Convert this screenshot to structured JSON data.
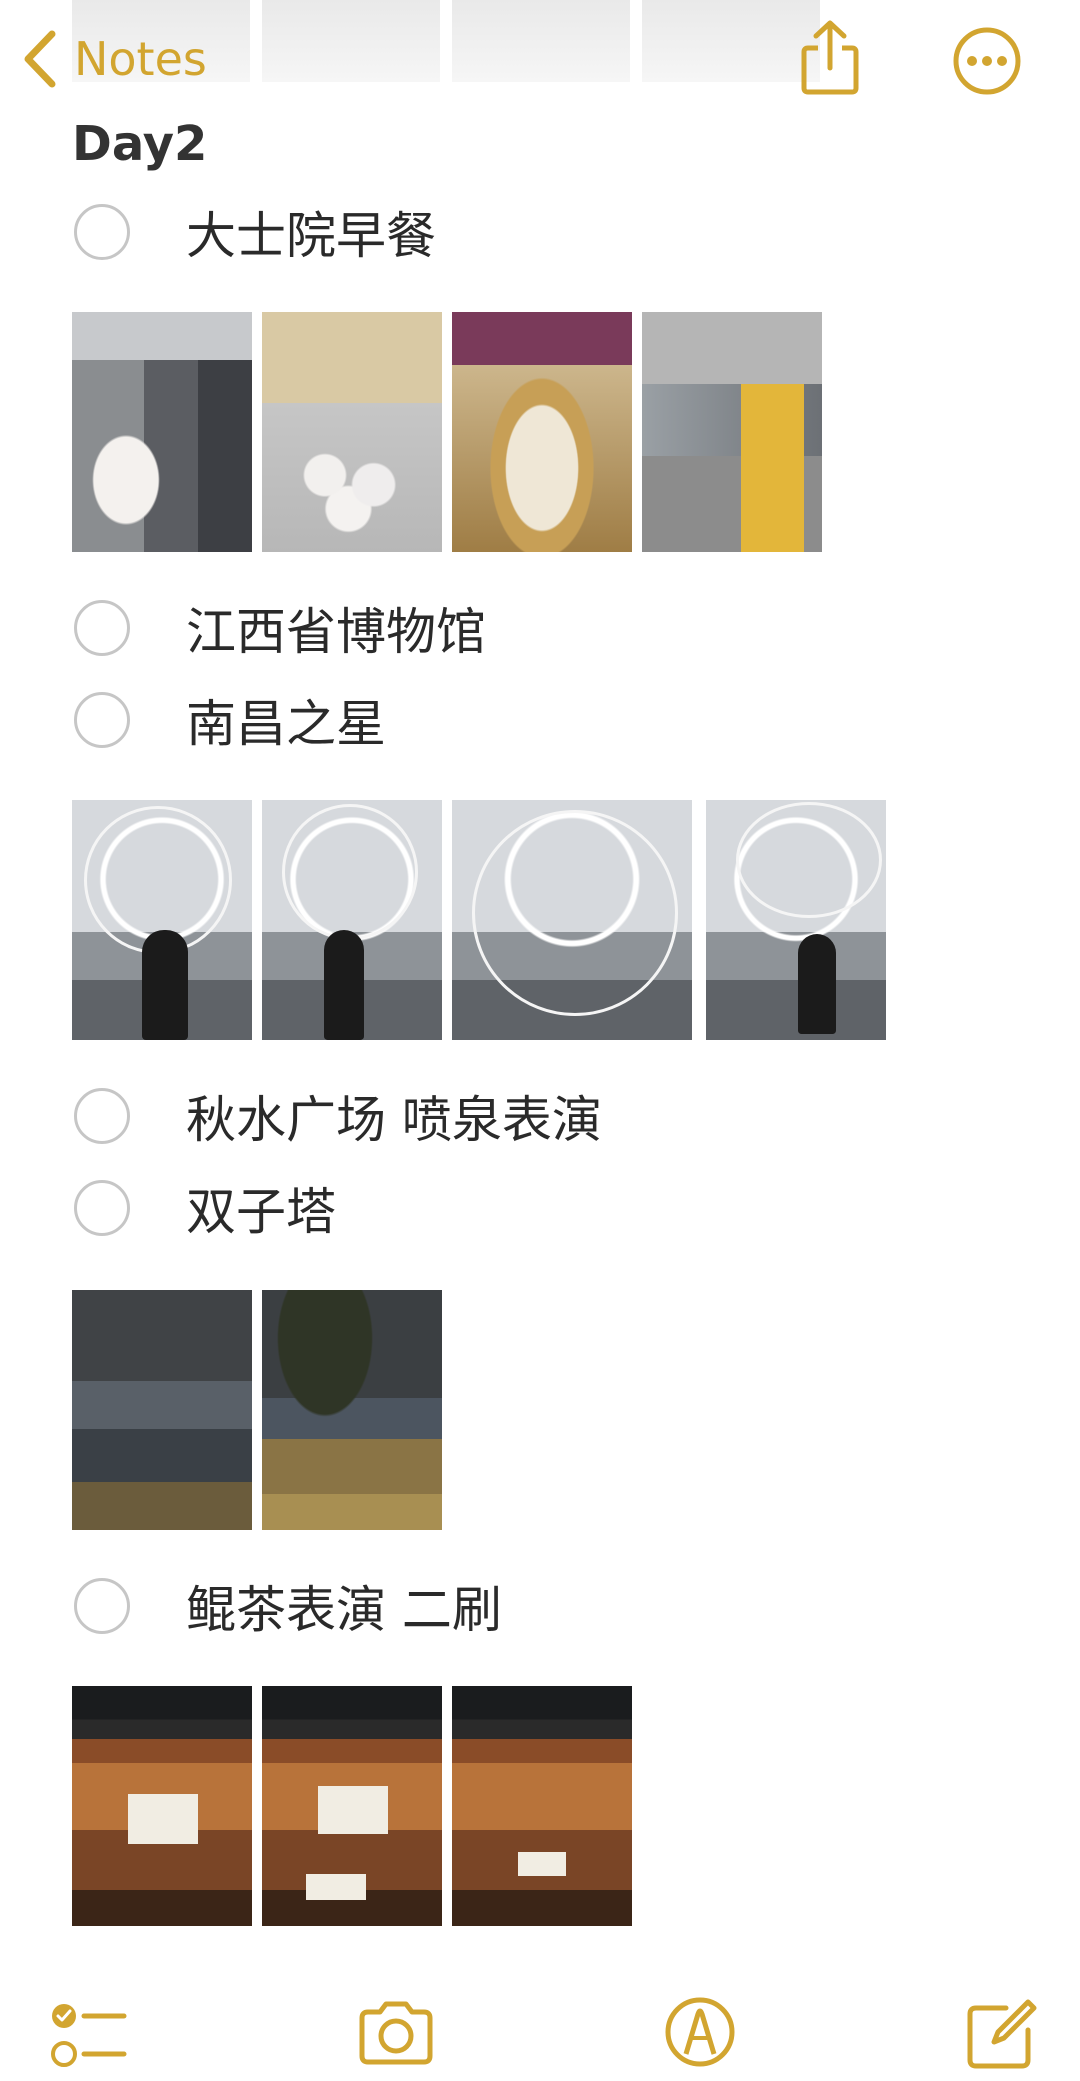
{
  "app": {
    "back_label": "Notes",
    "accent": "#d2a530"
  },
  "icons": {
    "back": "chevron-left-icon",
    "share": "share-icon",
    "more": "more-icon",
    "checklist": "checklist-icon",
    "camera": "camera-icon",
    "markup": "markup-pen-icon",
    "compose": "compose-icon"
  },
  "note": {
    "title": "Day2",
    "items": [
      {
        "label": "大士院早餐",
        "checked": false
      },
      {
        "label": "江西省博物馆",
        "checked": false
      },
      {
        "label": "南昌之星",
        "checked": false
      },
      {
        "label": "秋水广场 喷泉表演",
        "checked": false
      },
      {
        "label": "双子塔",
        "checked": false
      },
      {
        "label": "鲲茶表演 二刷",
        "checked": false
      }
    ]
  }
}
